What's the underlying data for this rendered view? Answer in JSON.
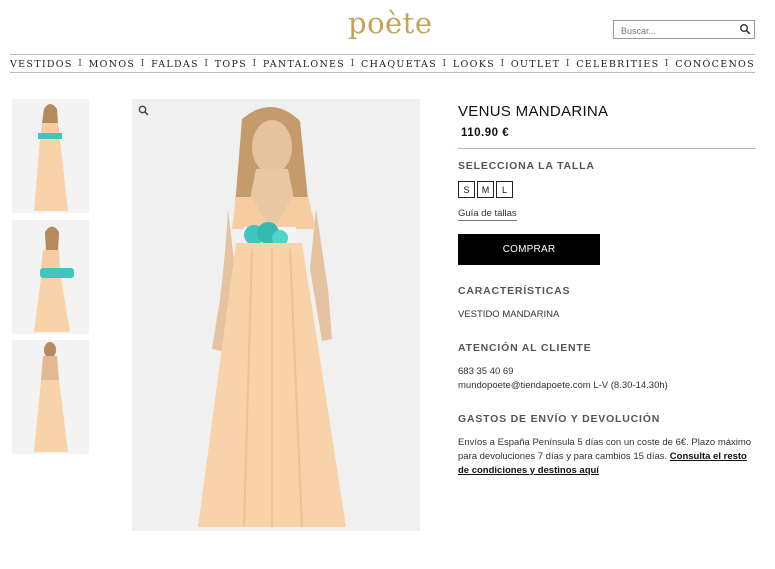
{
  "brand": {
    "logo": "poète"
  },
  "search": {
    "placeholder": "Buscar..."
  },
  "nav": {
    "items": [
      "VESTIDOS",
      "MONOS",
      "FALDAS",
      "TOPS",
      "PANTALONES",
      "CHAQUETAS",
      "LOOKS",
      "OUTLET",
      "CELEBRITIES",
      "CONÓCENOS"
    ],
    "separator": "I"
  },
  "product": {
    "name": "VENUS MANDARINA",
    "price": "110.90 €",
    "size_heading": "SELECCIONA LA TALLA",
    "sizes": [
      "S",
      "M",
      "L"
    ],
    "size_guide": "Guía de tallas",
    "buy_label": "COMPRAR",
    "features_heading": "CARACTERÍSTICAS",
    "features_text": "VESTIDO MANDARINA",
    "support_heading": "ATENCIÓN AL CLIENTE",
    "support_phone": "683 35 40 69",
    "support_email_hours": "mundopoete@tiendapoete.com L-V (8.30-14.30h)",
    "shipping_heading": "GASTOS DE ENVÍO Y DEVOLUCIÓN",
    "shipping_text": "Envíos a España Península 5 días con un coste de 6€. Plazo máximo para devoluciones 7 días y para cambios 15 días.",
    "shipping_link": "Consulta el resto de condiciones y destinos aquí"
  },
  "colors": {
    "brand_gold": "#c6a25a",
    "dress_peach": "#f7cfa3",
    "flower_turquoise": "#3fc7bf",
    "button_black": "#000000"
  },
  "icons": {
    "search": "search-icon",
    "zoom": "zoom-icon"
  }
}
